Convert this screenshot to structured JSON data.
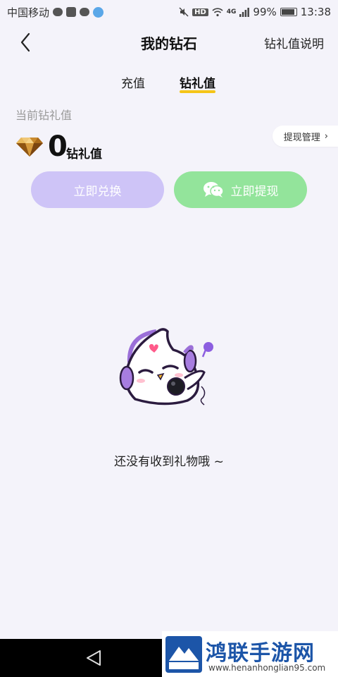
{
  "status_bar": {
    "carrier": "中国移动",
    "network": "4G",
    "hd": "HD",
    "battery": "99%",
    "time": "13:38"
  },
  "header": {
    "title": "我的钻石",
    "right_action": "钻礼值说明"
  },
  "tabs": [
    {
      "label": "充值",
      "active": false
    },
    {
      "label": "钻礼值",
      "active": true
    }
  ],
  "balance": {
    "label": "当前钻礼值",
    "value": "0",
    "unit": "钻礼值",
    "manage_label": "提现管理",
    "manage_chevron": "›"
  },
  "actions": {
    "exchange_label": "立即兑换",
    "withdraw_label": "立即提现"
  },
  "empty_state": {
    "message": "还没有收到礼物哦 ~"
  },
  "watermark": {
    "title": "鸿联手游网",
    "url": "www.henanhonglian95.com"
  },
  "colors": {
    "background": "#f4f3fa",
    "exchange_button": "#cec4f7",
    "withdraw_button": "#93e49b",
    "tab_underline": "#f5c518",
    "watermark_title": "#1c55a8"
  },
  "icons": [
    "back-chevron-icon",
    "diamond-icon",
    "wechat-icon",
    "chevron-right-icon",
    "mascot-illustration",
    "system-back-icon"
  ]
}
